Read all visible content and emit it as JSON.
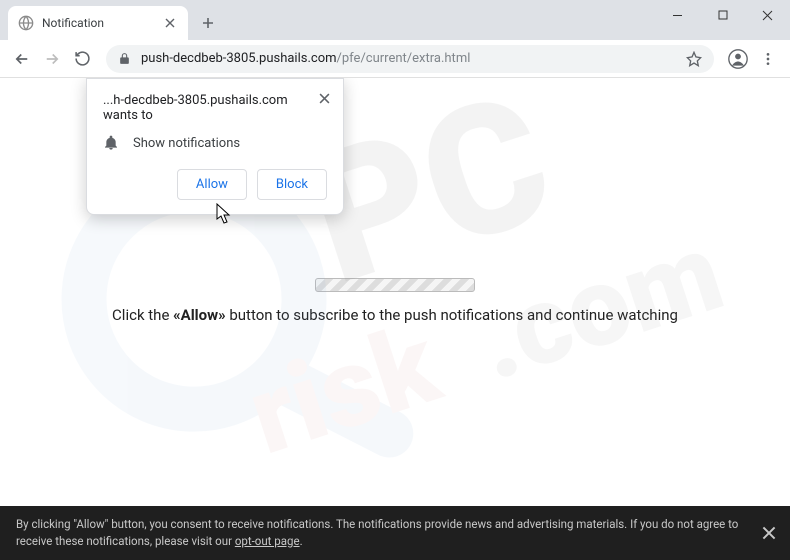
{
  "titlebar": {
    "tab_title": "Notification"
  },
  "toolbar": {
    "url_host": "push-decdbeb-3805.pushails.com",
    "url_path": "/pfe/current/extra.html"
  },
  "prompt": {
    "title": "...h-decdbeb-3805.pushails.com wants to",
    "permission_text": "Show notifications",
    "allow_label": "Allow",
    "block_label": "Block"
  },
  "page": {
    "instruction_prefix": "Click the ",
    "instruction_bold": "«Allow»",
    "instruction_suffix": " button to subscribe to the push notifications and continue watching"
  },
  "cookie": {
    "text_part1": "By clicking \"Allow\" button, you consent to receive notifications. The notifications provide news and advertising materials. If you do not agree to receive these notifications, please visit our ",
    "link_text": "opt-out page",
    "text_part2": "."
  },
  "watermark": {
    "line1": "PC",
    "line2": "risk.com"
  }
}
